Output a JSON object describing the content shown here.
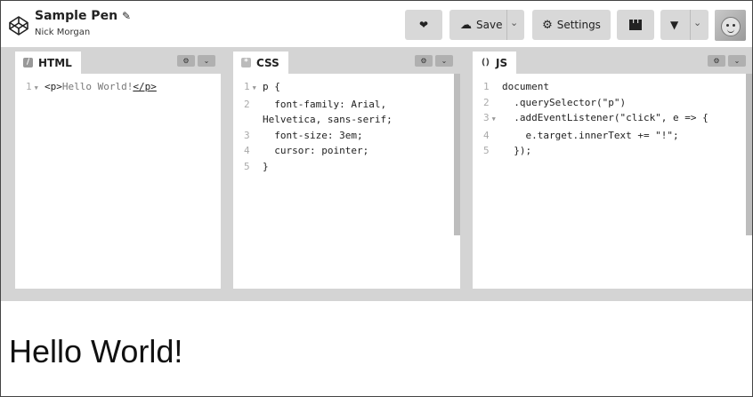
{
  "header": {
    "title": "Sample Pen",
    "author": "Nick Morgan",
    "buttons": {
      "save_label": "Save",
      "settings_label": "Settings"
    },
    "icons": [
      "codepen-logo-icon",
      "pencil-icon",
      "heart-icon",
      "cloud-icon",
      "chevron-down-icon",
      "gear-icon",
      "layout-icon",
      "pin-icon",
      "avatar"
    ]
  },
  "panes": {
    "html": {
      "label": "HTML",
      "lines": [
        {
          "num": "1",
          "text": "<p>Hello World!</p>"
        }
      ]
    },
    "css": {
      "label": "CSS",
      "lines": [
        {
          "num": "1",
          "text": "p {"
        },
        {
          "num": "2",
          "text": "  font-family: Arial,"
        },
        {
          "num": "",
          "text": "Helvetica, sans-serif;"
        },
        {
          "num": "3",
          "text": "  font-size: 3em;"
        },
        {
          "num": "4",
          "text": "  cursor: pointer;"
        },
        {
          "num": "5",
          "text": "}"
        }
      ]
    },
    "js": {
      "label": "JS",
      "lines": [
        {
          "num": "1",
          "text": "document"
        },
        {
          "num": "2",
          "text": "  .querySelector(\"p\")"
        },
        {
          "num": "3",
          "text": "  .addEventListener(\"click\", e => {"
        },
        {
          "num": "4",
          "text": "    e.target.innerText += \"!\";"
        },
        {
          "num": "5",
          "text": "  });"
        }
      ]
    }
  },
  "result": {
    "text": "Hello World!"
  }
}
